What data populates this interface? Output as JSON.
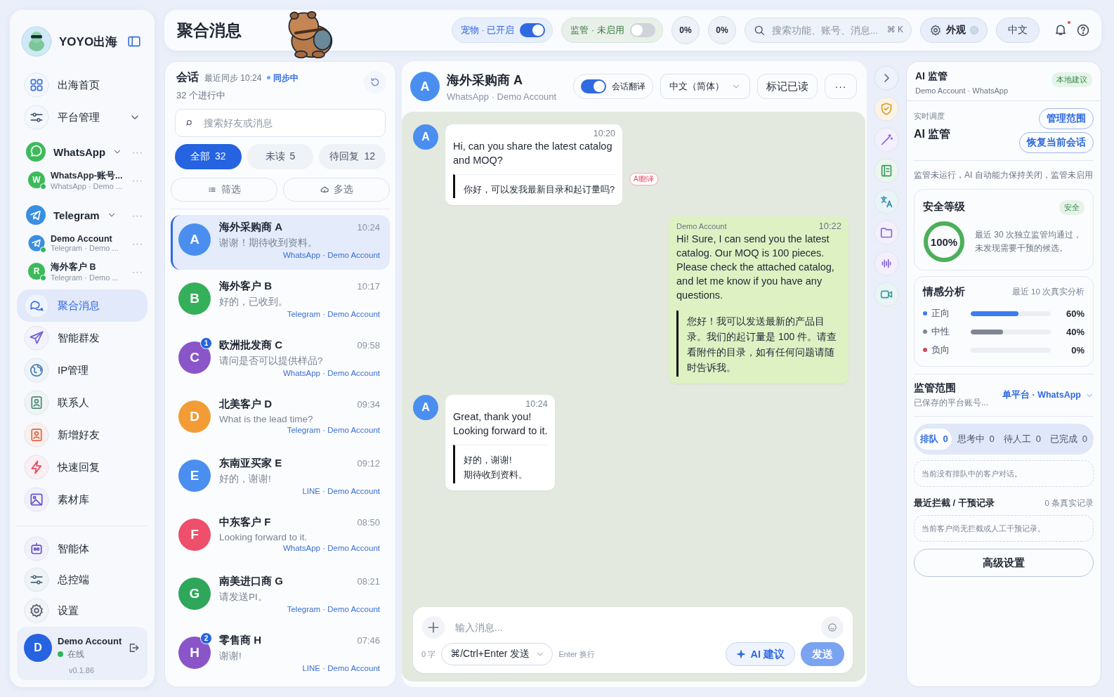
{
  "sidebar": {
    "brand": "YOYO出海",
    "nav_top": [
      {
        "label": "出海首页",
        "kind": "link"
      },
      {
        "label": "平台管理",
        "kind": "dropdown"
      }
    ],
    "platforms": [
      {
        "name": "WhatsApp",
        "expanded": true,
        "more": "···",
        "accounts": [
          {
            "avatar_letter": "W",
            "name": "WhatsApp-账号...",
            "subtitle": "WhatsApp · Demo ...",
            "color": "#3dba5a",
            "online": true
          }
        ]
      },
      {
        "name": "Telegram",
        "expanded": true,
        "more": "···",
        "accounts": [
          {
            "name": "Demo Account",
            "subtitle": "Telegram · Demo ...",
            "color": "#3a8fe0",
            "online": true
          },
          {
            "avatar_letter": "R",
            "name": "海外客户 B",
            "subtitle": "Telegram · Demo ...",
            "color": "#3dba5a",
            "online": true
          }
        ]
      }
    ],
    "nav": [
      {
        "label": "聚合消息",
        "selected": true
      },
      {
        "label": "智能群发",
        "selected": false
      },
      {
        "label": "IP管理",
        "selected": false
      },
      {
        "label": "联系人",
        "selected": false
      },
      {
        "label": "新增好友",
        "selected": false
      },
      {
        "label": "快速回复",
        "selected": false
      },
      {
        "label": "素材库",
        "selected": false
      }
    ],
    "nav_bottom": [
      {
        "label": "智能体",
        "selected": false
      },
      {
        "label": "总控端",
        "selected": false
      },
      {
        "label": "设置",
        "selected": false
      }
    ],
    "user": {
      "avatar_letter": "D",
      "name": "Demo Account",
      "status": "在线",
      "online": true,
      "version": "v0.1.86"
    }
  },
  "header": {
    "title": "聚合消息",
    "toggles": [
      {
        "label": "宠物 · 已开启",
        "on": true
      },
      {
        "label": "监管 · 未启用",
        "on": false
      }
    ],
    "meters": [
      "0%",
      "0%"
    ],
    "search": {
      "placeholder": "搜索功能、账号、消息...",
      "shortcut": "⌘ K"
    },
    "appearance": "外观",
    "language": "中文",
    "notifications": true
  },
  "conversations": {
    "title": "会话",
    "sync_time": "最近同步 10:24",
    "sync_status": "同步中",
    "active_count": "32 个进行中",
    "search": {
      "placeholder": "搜索好友或消息"
    },
    "tabs": [
      {
        "label": "全部",
        "count": "32",
        "selected": true
      },
      {
        "label": "未读",
        "count": "5",
        "selected": false
      },
      {
        "label": "待回复",
        "count": "12",
        "selected": false
      }
    ],
    "actions": [
      "筛选",
      "多选"
    ],
    "items": [
      {
        "letter": "A",
        "color": "#4a8ff0",
        "name": "海外采购商 A",
        "time": "10:24",
        "preview": "谢谢！期待收到资料。",
        "source": "WhatsApp · Demo Account",
        "selected": true
      },
      {
        "letter": "B",
        "color": "#35b05a",
        "name": "海外客户 B",
        "time": "10:17",
        "preview": "好的，已收到。",
        "source": "Telegram · Demo Account",
        "selected": false
      },
      {
        "letter": "C",
        "color": "#8a55c8",
        "name": "欧洲批发商 C",
        "time": "09:58",
        "preview": "请问是否可以提供样品?",
        "source": "WhatsApp · Demo Account",
        "unread": "1",
        "selected": false
      },
      {
        "letter": "D",
        "color": "#f39b35",
        "name": "北美客户 D",
        "time": "09:34",
        "preview": "What is the lead time?",
        "source": "Telegram · Demo Account",
        "selected": false
      },
      {
        "letter": "E",
        "color": "#4a8ff0",
        "name": "东南亚买家 E",
        "time": "09:12",
        "preview": "好的，谢谢!",
        "source": "LINE · Demo Account",
        "selected": false
      },
      {
        "letter": "F",
        "color": "#ee4f6a",
        "name": "中东客户 F",
        "time": "08:50",
        "preview": "Looking forward to it.",
        "source": "WhatsApp · Demo Account",
        "selected": false
      },
      {
        "letter": "G",
        "color": "#2ea75a",
        "name": "南美进口商 G",
        "time": "08:21",
        "preview": "请发送PI。",
        "source": "Telegram · Demo Account",
        "selected": false
      },
      {
        "letter": "H",
        "color": "#8a55c8",
        "name": "零售商 H",
        "time": "07:46",
        "preview": "谢谢!",
        "source": "LINE · Demo Account",
        "unread": "2",
        "selected": false
      }
    ]
  },
  "chat": {
    "letter": "A",
    "color": "#4a8ff0",
    "name": "海外采购商 A",
    "subtitle": "WhatsApp · Demo Account",
    "translate": {
      "label": "会话翻译",
      "on": true
    },
    "language": "中文（简体）",
    "mark_read": "标记已读",
    "more": "···",
    "messages": [
      {
        "kind": "incoming",
        "letter": "A",
        "time": "10:20",
        "text": "Hi, can you share the latest catalog and MOQ?",
        "translation": "你好，可以发我最新目录和起订量吗?",
        "badge": "AI翻译"
      },
      {
        "kind": "outgoing",
        "sender": "Demo Account",
        "time": "10:22",
        "text": "Hi! Sure, I can send you the latest catalog. Our MOQ is 100 pieces. Please check the attached catalog, and let me know if you have any questions.",
        "translation": "您好！我可以发送最新的产品目录。我们的起订量是 100 件。请查看附件的目录，如有任何问题请随时告诉我。"
      },
      {
        "kind": "incoming",
        "letter": "A",
        "time": "10:24",
        "text": "Great, thank you!\nLooking forward to it.",
        "translation": "好的，谢谢!\n期待收到资料。"
      }
    ],
    "composer": {
      "placeholder": "输入消息...",
      "char_count": "0 字",
      "send_mode": "⌘/Ctrl+Enter 发送",
      "newline_hint": "Enter 换行",
      "ai_suggest": "AI 建议",
      "send": "发送"
    }
  },
  "monitor": {
    "title": "AI 监管",
    "subtitle": "Demo Account · WhatsApp",
    "badge": "本地建议",
    "schedule_label": "实时调度",
    "schedule_title": "AI 监管",
    "buttons": [
      "管理范围",
      "恢复当前会话"
    ],
    "note": "监管未运行，AI 自动能力保持关闭，监管未启用",
    "safety": {
      "title": "安全等级",
      "badge": "安全",
      "level": 1,
      "reading": "100%",
      "description": "最近 30 次独立监管均通过，未发现需要干预的候选。"
    },
    "sentiment": {
      "title": "情感分析",
      "meta": "最近 10 次真实分析",
      "rows": [
        {
          "label": "正向",
          "color": "#3b7cf0",
          "level": 0.6,
          "reading": "60%"
        },
        {
          "label": "中性",
          "color": "#7d8494",
          "level": 0.4,
          "reading": "40%"
        },
        {
          "label": "负向",
          "color": "#d9475a",
          "level": 0,
          "reading": "0%"
        }
      ]
    },
    "scope": {
      "title": "监管范围",
      "subtitle": "已保存的平台账号...",
      "value": "单平台 · WhatsApp"
    },
    "queue": [
      {
        "label": "排队",
        "count": "0",
        "selected": true
      },
      {
        "label": "思考中",
        "count": "0",
        "selected": false
      },
      {
        "label": "待人工",
        "count": "0",
        "selected": false
      },
      {
        "label": "已完成",
        "count": "0",
        "selected": false
      }
    ],
    "queue_empty": "当前没有排队中的客户对话。",
    "records_title": "最近拦截 / 干预记录",
    "records_count": "0 条真实记录",
    "records_empty": "当前客户尚无拦截或人工干预记录。",
    "advanced": "高级设置"
  }
}
